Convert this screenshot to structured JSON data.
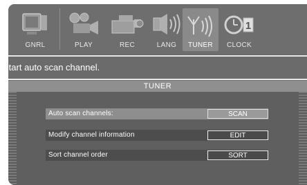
{
  "toolbar": {
    "items": [
      {
        "label": "GNRL",
        "icon": "tv-monitor-icon"
      },
      {
        "label": "PLAY",
        "icon": "film-projector-icon"
      },
      {
        "label": "REC",
        "icon": "video-camera-icon"
      },
      {
        "label": "LANG",
        "icon": "speaker-icon"
      },
      {
        "label": "TUNER",
        "icon": "antenna-icon",
        "selected": true
      },
      {
        "label": "CLOCK",
        "icon": "clock-icon"
      }
    ]
  },
  "status": {
    "text": "Start auto scan channel."
  },
  "panel": {
    "title": "TUNER",
    "rows": [
      {
        "label": "Auto scan channels:",
        "button": "SCAN",
        "highlighted": true
      },
      {
        "label": "Modify channel information",
        "button": "EDIT"
      },
      {
        "label": "Sort channel order",
        "button": "SORT"
      }
    ]
  },
  "colors": {
    "background": "#6a6a6a",
    "selected_tab": "#8a8a8a",
    "highlight_row": "#8e8e8e",
    "text": "#ffffff"
  }
}
